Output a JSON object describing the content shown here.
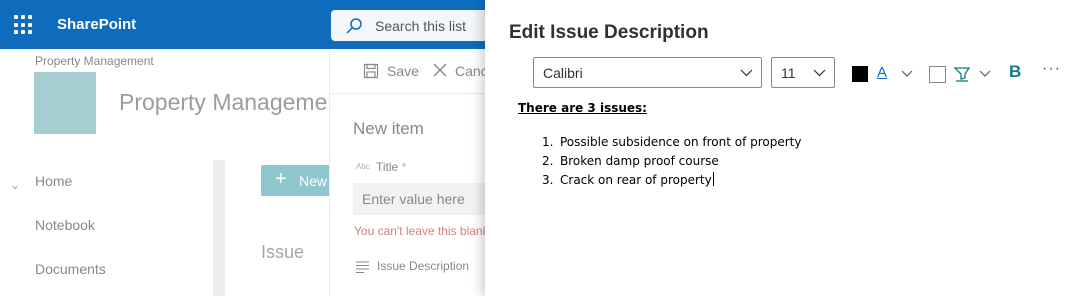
{
  "suite": {
    "brand": "SharePoint",
    "search_placeholder": "Search this list"
  },
  "site": {
    "breadcrumb": "Property Management",
    "title": "Property Management"
  },
  "nav": {
    "items": [
      "Home",
      "Notebook",
      "Documents"
    ]
  },
  "list": {
    "new_label": "New",
    "column_header": "Issue"
  },
  "form": {
    "save_label": "Save",
    "cancel_label": "Cancel",
    "heading": "New item",
    "title_label": "Title",
    "required_mark": "*",
    "title_placeholder": "Enter value here",
    "error": "You can't leave this blank.",
    "description_label": "Issue Description"
  },
  "editor": {
    "title": "Edit Issue Description",
    "font": "Calibri",
    "size": "11",
    "font_color_glyph": "A",
    "bold_glyph": "B",
    "more_glyph": "···",
    "content": {
      "heading": "There are 3 issues:",
      "items": [
        {
          "num": "1.",
          "text": "Possible subsidence on front of property"
        },
        {
          "num": "2.",
          "text": "Broken damp proof course"
        },
        {
          "num": "3.",
          "text": "Crack on rear of property"
        }
      ]
    }
  },
  "colors": {
    "suitebar": "#0f6cbd",
    "site_logo": "#a6cdd2",
    "bold_accent": "#0f7c80",
    "error": "#d08080"
  }
}
